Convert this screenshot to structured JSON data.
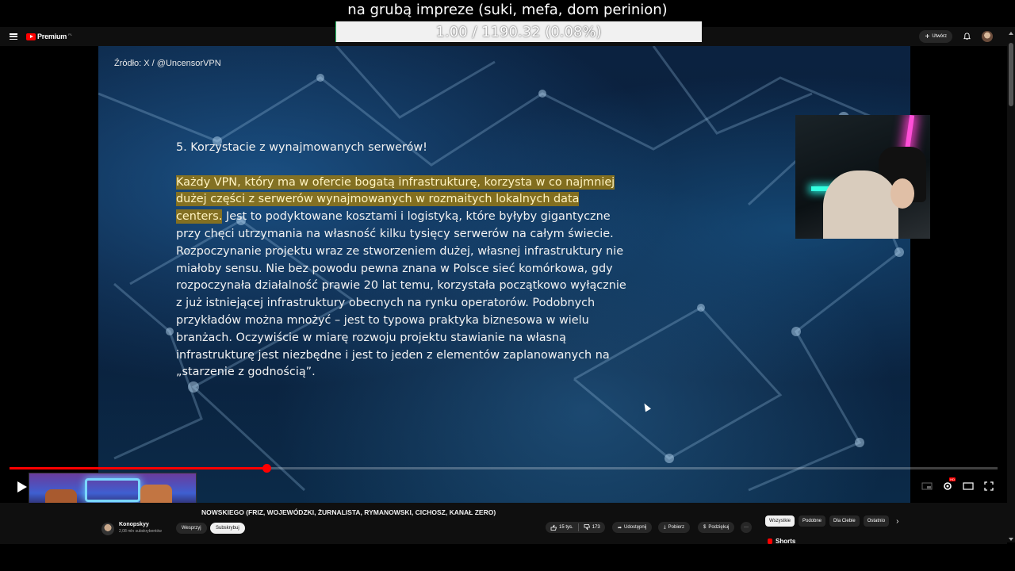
{
  "overlay": {
    "title": "na grubą impreze (suki, mefa, dom perinion)",
    "progress_text": "1.00 / 1190.32 (0.08%)",
    "progress_percent": 0.08
  },
  "topbar": {
    "logo_text": "Premium",
    "logo_region": "PL",
    "create_label": "Utwórz"
  },
  "slide": {
    "source": "Źródło: X / @UncensorVPN",
    "heading": "5. Korzystacie z wynajmowanych serwerów!",
    "highlighted": "Każdy VPN, który ma w ofercie bogatą infrastrukturę, korzysta w co najmniej dużej części z serwerów wynajmowanych w rozmaitych lokalnych data centers.",
    "rest": " Jest to podyktowane kosztami i logistyką, które byłyby gigantyczne przy chęci utrzymania na własność kilku tysięcy serwerów na całym świecie.",
    "paragraph2": "Rozpoczynanie projektu wraz ze stworzeniem dużej, własnej infrastruktury nie miałoby sensu. Nie bez powodu pewna znana w Polsce sieć komórkowa, gdy rozpoczynała działalność prawie 20 lat temu, korzystała początkowo wyłącznie z już istniejącej infrastruktury obecnych na rynku operatorów. Podobnych przykładów można mnożyć – jest to typowa praktyka biznesowa w wielu branżach. Oczywiście w miarę rozwoju projektu stawianie na własną infrastrukturę jest niezbędne i jest to jeden z elementów zaplanowanych na „starzenie z godnością”."
  },
  "player": {
    "played_fraction": 0.26,
    "hd_badge": "HD"
  },
  "video_info": {
    "title": "NOWSKIEGO (FRIZ, WOJEWÓDZKI, ŻURNALISTA, RYMANOWSKI, CICHOSZ, KANAŁ ZERO)",
    "channel_name": "Konopskyy",
    "channel_subs": "2,08 mln subskrybentów",
    "support_label": "Wesprzyj",
    "subscribe_label": "Subskrybuj",
    "likes": "15 tys.",
    "dislikes": "173",
    "share_label": "Udostępnij",
    "download_label": "Pobierz",
    "thanks_label": "Podziękuj",
    "more_label": "···"
  },
  "sidebar": {
    "chips": [
      "Wszystkie",
      "Podobne",
      "Dla Ciebie",
      "Ostatnio"
    ],
    "shorts_label": "Shorts"
  },
  "colors": {
    "accent": "#ff0000",
    "highlight": "#96781e",
    "background": "#0f0f0f"
  }
}
